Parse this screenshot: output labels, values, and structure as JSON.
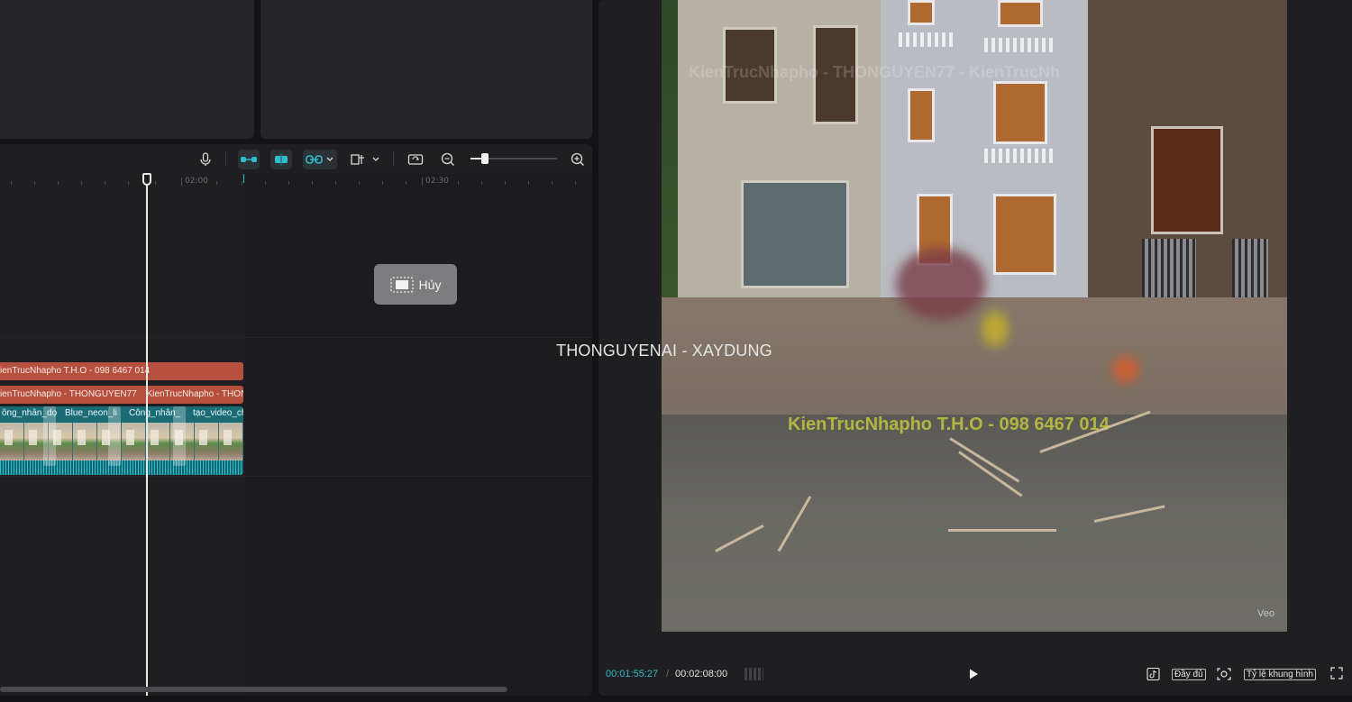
{
  "timeline": {
    "ruler": {
      "labels": [
        "02:00",
        "02:30"
      ]
    },
    "tracks": {
      "text_track_1": {
        "clips": [
          "ienTrucNhapho T.H.O - 098 6467 014"
        ]
      },
      "text_track_2": {
        "clips": [
          "ienTrucNhapho - THONGUYEN77",
          "KienTrucNhapho - THONG"
        ]
      },
      "video_track": {
        "clips": [
          "ông_nhân_dọ",
          "Blue_neon_li",
          "Công_nhân_",
          "tạo_video_ch"
        ]
      }
    },
    "cancel_button": {
      "label": "Hủy"
    },
    "zoom": {
      "level": 0.17
    }
  },
  "preview": {
    "overlay_text": "THONGUYENAI - XAYDUNG",
    "watermark_main": "KienTrucNhapho T.H.O - 098 6467 014",
    "watermark_faint": "KienTrucNhapho - THONGUYEN77 - KienTrucNh",
    "watermark_corner": "Veo",
    "current_time": "00:01:55:27",
    "time_separator": "/",
    "total_time": "00:02:08:00",
    "full_label": "Đầy đủ",
    "ratio_label": "Tỷ lệ khung hình"
  },
  "colors": {
    "accent": "#2fbccb",
    "text_clip": "#b5503f",
    "video_clip": "#1a6b74"
  },
  "icons": {
    "mic": "microphone-icon",
    "link_main": "main-track-magnet-icon",
    "split": "auto-snap-icon",
    "link": "linkage-icon",
    "preview_axis": "preview-axis-icon",
    "replace": "replace-clip-icon",
    "zoom_out": "zoom-out-icon",
    "zoom_in": "zoom-in-icon",
    "play": "play-icon",
    "tiktok": "tiktok-icon",
    "snapshot": "snapshot-icon",
    "fullscreen": "fullscreen-icon"
  }
}
